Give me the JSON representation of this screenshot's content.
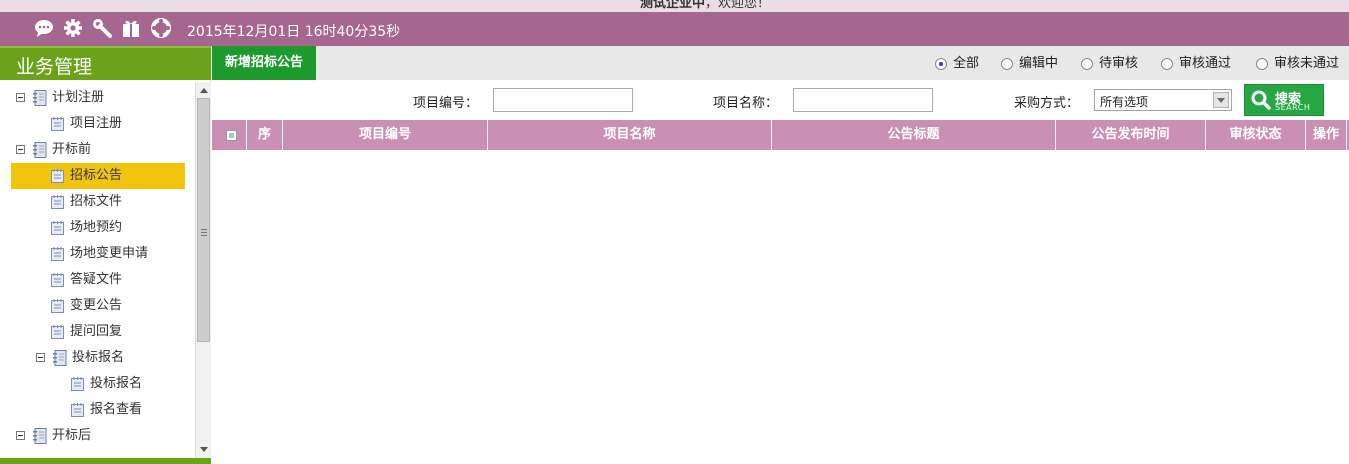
{
  "header": {
    "welcome_bold": "测试企业中",
    "welcome_rest": "，欢迎您！",
    "datetime": "2015年12月01日 16时40分35秒",
    "icons": [
      "chat-icon",
      "gear-icon",
      "tools-icon",
      "gift-icon",
      "lifebuoy-icon"
    ]
  },
  "sidebar": {
    "title": "业务管理",
    "tree": [
      {
        "label": "计划注册",
        "type": "folder",
        "expanded": true
      },
      {
        "label": "项目注册",
        "type": "leaf"
      },
      {
        "label": "开标前",
        "type": "folder",
        "expanded": true
      },
      {
        "label": "招标公告",
        "type": "leaf",
        "selected": true
      },
      {
        "label": "招标文件",
        "type": "leaf"
      },
      {
        "label": "场地预约",
        "type": "leaf"
      },
      {
        "label": "场地变更申请",
        "type": "leaf"
      },
      {
        "label": "答疑文件",
        "type": "leaf"
      },
      {
        "label": "变更公告",
        "type": "leaf"
      },
      {
        "label": "提问回复",
        "type": "leaf"
      },
      {
        "label": "投标报名",
        "type": "folder",
        "expanded": true
      },
      {
        "label": "投标报名",
        "type": "leaf"
      },
      {
        "label": "报名查看",
        "type": "leaf"
      },
      {
        "label": "开标后",
        "type": "folder",
        "expanded": true
      }
    ]
  },
  "toolbar": {
    "new_button": "新增招标公告",
    "filters": [
      {
        "label": "全部",
        "checked": true
      },
      {
        "label": "编辑中",
        "checked": false
      },
      {
        "label": "待审核",
        "checked": false
      },
      {
        "label": "审核通过",
        "checked": false
      },
      {
        "label": "审核未通过",
        "checked": false
      }
    ]
  },
  "search": {
    "project_no_label": "项目编号：",
    "project_no_value": "",
    "project_name_label": "项目名称：",
    "project_name_value": "",
    "method_label": "采购方式：",
    "method_value": "所有选项",
    "button_label": "搜索",
    "button_sub": "SEARCH"
  },
  "table": {
    "columns": [
      "序",
      "项目编号",
      "项目名称",
      "公告标题",
      "公告发布时间",
      "审核状态",
      "操作"
    ],
    "rows": []
  },
  "colors": {
    "toolbar_bg": "#a5668f",
    "sidebar_green": "#6aa319",
    "new_button_green": "#1c9a2c",
    "table_header": "#c990b4",
    "selected_item": "#f1c40f"
  }
}
